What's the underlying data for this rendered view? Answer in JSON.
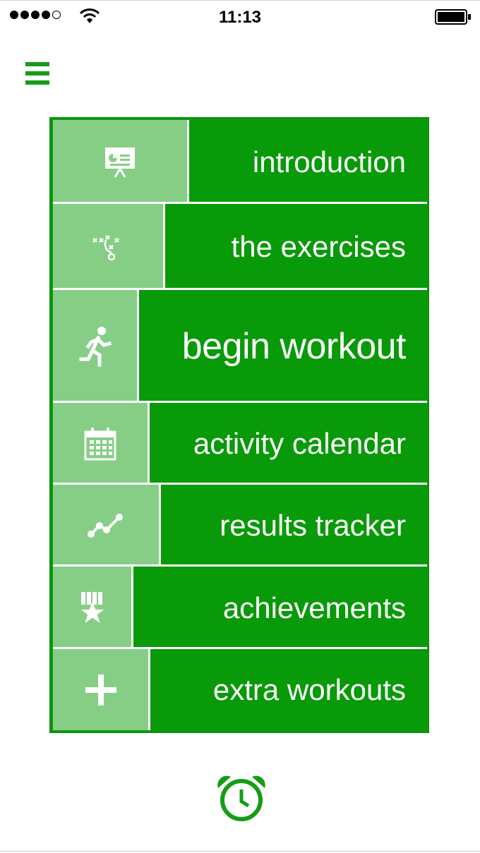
{
  "status_bar": {
    "time": "11:13",
    "signal_bars_filled": 4,
    "signal_bars_total": 5,
    "wifi_icon": "wifi-icon",
    "battery_icon": "battery-icon"
  },
  "header": {
    "menu_icon": "hamburger-menu-icon"
  },
  "menu": {
    "colors": {
      "panel": "#099a09",
      "tile": "#86ce86",
      "text": "#ffffff",
      "accent": "#169c16"
    },
    "items": [
      {
        "label": "introduction",
        "icon": "presentation-icon"
      },
      {
        "label": "the exercises",
        "icon": "play-diagram-icon"
      },
      {
        "label": "begin workout",
        "icon": "running-man-icon"
      },
      {
        "label": "activity calendar",
        "icon": "calendar-icon"
      },
      {
        "label": "results tracker",
        "icon": "line-graph-icon"
      },
      {
        "label": "achievements",
        "icon": "medal-icon"
      },
      {
        "label": "extra workouts",
        "icon": "plus-icon"
      }
    ]
  },
  "footer": {
    "alarm_icon": "alarm-clock-icon"
  }
}
